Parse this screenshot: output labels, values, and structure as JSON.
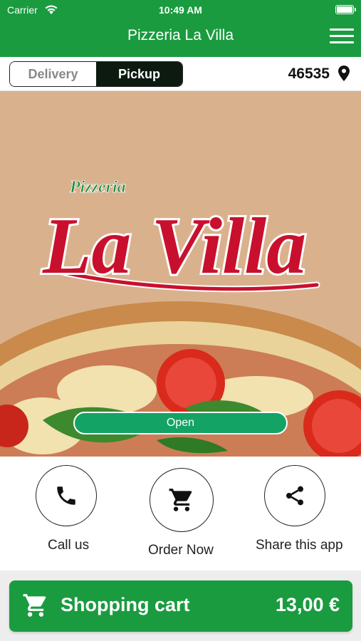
{
  "status_bar": {
    "carrier": "Carrier",
    "time": "10:49 AM"
  },
  "header": {
    "title": "Pizzeria La Villa"
  },
  "mode_toggle": {
    "delivery_label": "Delivery",
    "pickup_label": "Pickup",
    "selected": "Pickup"
  },
  "location": {
    "zip": "46535"
  },
  "hero": {
    "logo_small": "Pizzeria",
    "logo_large": "La Villa",
    "status_label": "Open"
  },
  "actions": {
    "call_label": "Call us",
    "order_label": "Order Now",
    "share_label": "Share this app"
  },
  "cart": {
    "label": "Shopping cart",
    "total": "13,00 €"
  },
  "colors": {
    "brand_green": "#1a9b3f",
    "open_green": "#13a365",
    "logo_red": "#c8102e",
    "hero_bg": "#d9b28d"
  },
  "icons": [
    "wifi-icon",
    "battery-icon",
    "menu-icon",
    "location-pin-icon",
    "phone-icon",
    "cart-icon",
    "share-icon"
  ]
}
